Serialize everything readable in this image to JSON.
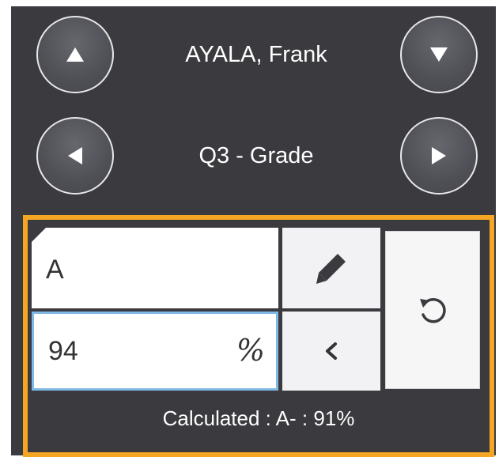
{
  "student_nav": {
    "name": "AYALA, Frank",
    "prev_icon": "triangle-up-icon",
    "next_icon": "triangle-down-icon"
  },
  "column_nav": {
    "label": "Q3 - Grade",
    "prev_icon": "triangle-left-icon",
    "next_icon": "triangle-right-icon"
  },
  "editor": {
    "letter_grade": "A",
    "percent_value": "94",
    "percent_symbol": "%",
    "edit_icon": "pencil-icon",
    "back_icon": "chevron-left-icon",
    "reset_icon": "undo-icon",
    "calculated_text": "Calculated : A- : 91%"
  },
  "colors": {
    "panel_bg": "#3a3a3f",
    "highlight_border": "#f5a623",
    "focus_border": "#7fb9e6"
  }
}
